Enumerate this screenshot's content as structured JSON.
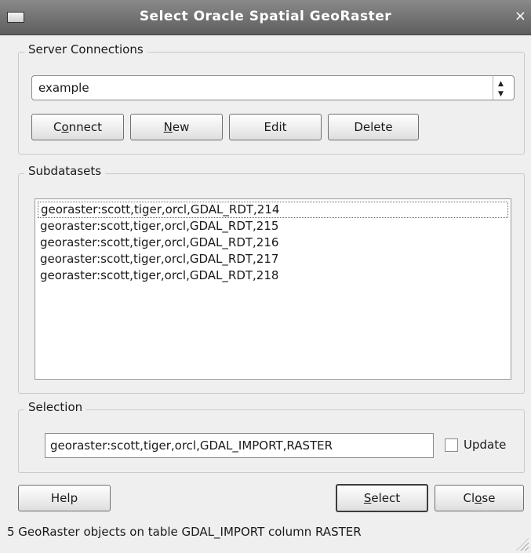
{
  "window": {
    "title": "Select Oracle Spatial GeoRaster",
    "close_glyph": "×"
  },
  "server_connections": {
    "label": "Server Connections",
    "selected": "example",
    "arrow_up": "▲",
    "arrow_down": "▼",
    "buttons": {
      "connect_pre": "C",
      "connect_ul": "o",
      "connect_post": "nnect",
      "new_ul": "N",
      "new_post": "ew",
      "edit": "Edit",
      "delete": "Delete"
    }
  },
  "subdatasets": {
    "label": "Subdatasets",
    "items": [
      "georaster:scott,tiger,orcl,GDAL_RDT,214",
      "georaster:scott,tiger,orcl,GDAL_RDT,215",
      "georaster:scott,tiger,orcl,GDAL_RDT,216",
      "georaster:scott,tiger,orcl,GDAL_RDT,217",
      "georaster:scott,tiger,orcl,GDAL_RDT,218"
    ]
  },
  "selection": {
    "label": "Selection",
    "value": "georaster:scott,tiger,orcl,GDAL_IMPORT,RASTER",
    "update_label": "Update",
    "update_checked": false
  },
  "footer": {
    "help": "Help",
    "select_ul": "S",
    "select_post": "elect",
    "close_pre": "Cl",
    "close_ul": "o",
    "close_post": "se",
    "status": "5 GeoRaster objects on table GDAL_IMPORT column RASTER"
  },
  "icons": {
    "window_menu": "window-menu-icon",
    "close": "close-icon",
    "combo_arrows": "up-down-arrows-icon",
    "resize": "resize-grip-icon"
  }
}
